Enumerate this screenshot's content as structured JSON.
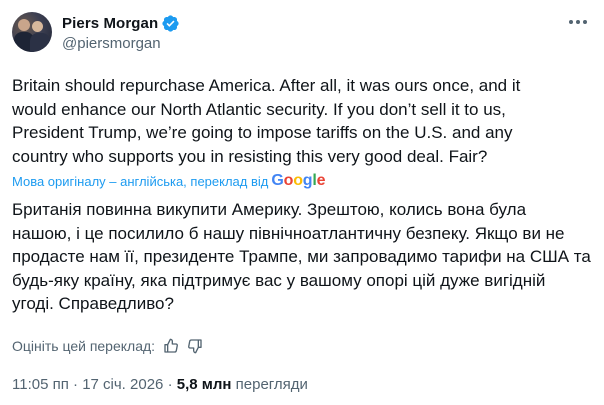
{
  "author": {
    "name": "Piers Morgan",
    "handle": "@piersmorgan"
  },
  "tweet": {
    "text": "Britain should repurchase America. After all, it was ours once, and it\nwould enhance our North Atlantic security. If you don’t sell it to us,\nPresident Trump, we’re going to impose tariffs on the U.S. and any\ncountry who supports you in resisting this very good deal. Fair?",
    "translation_note": "Мова оригіналу – англійська, переклад від",
    "translation_provider": "Google",
    "translated_text": "Британія повинна викупити Америку. Зрештою, колись вона була\nнашою, і це посилило б нашу північноатлантичну безпеку. Якщо ви не\nпродасте нам її, президенте Трампе, ми запровадимо тарифи на США та\nбудь-яку країну, яка підтримує вас у вашому опорі цій дуже вигідній\nугоді. Справедливо?",
    "rate_translation": "Оцініть цей переклад:"
  },
  "meta": {
    "time": "11:05 пп",
    "separator": "·",
    "date": "17 січ. 2026",
    "views_count": "5,8 млн",
    "views_label": "перегляди"
  },
  "icons": {
    "verified": "verified-badge-icon",
    "more": "more-options-icon",
    "thumb_up": "thumbs-up-icon",
    "thumb_down": "thumbs-down-icon"
  },
  "colors": {
    "accent": "#1d9bf0",
    "secondary_text": "#536471",
    "primary_text": "#0f1419"
  }
}
